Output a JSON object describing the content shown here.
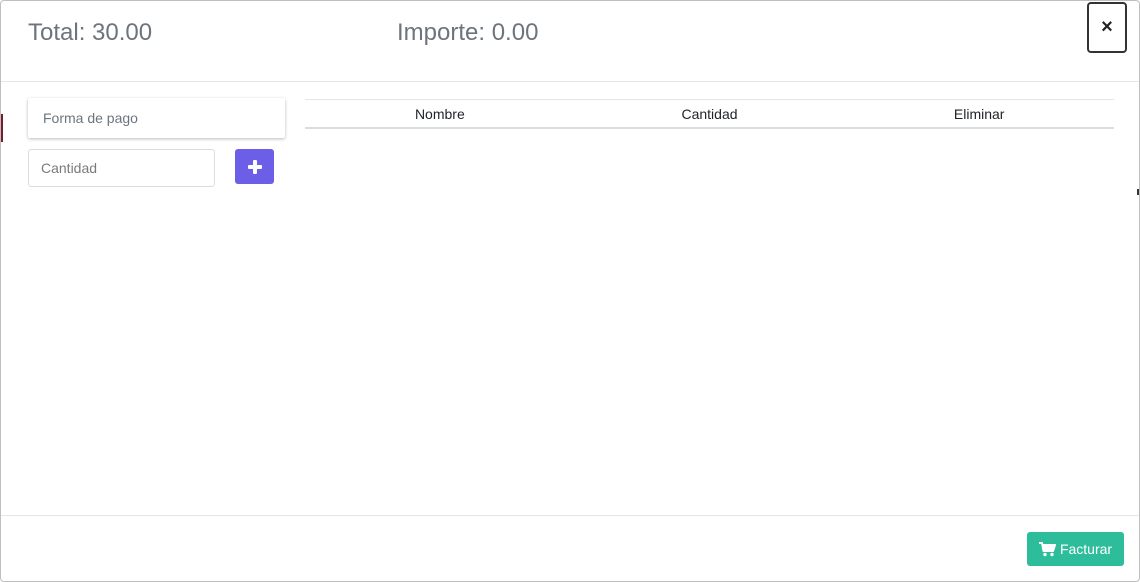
{
  "header": {
    "total_text": "Total: 30.00",
    "importe_text": "Importe: 0.00",
    "close_label": "×"
  },
  "form": {
    "payment_method_placeholder": "Forma de pago",
    "quantity_placeholder": "Cantidad",
    "add_icon": "plus-icon"
  },
  "table": {
    "columns": [
      "Nombre",
      "Cantidad",
      "Eliminar"
    ],
    "rows": []
  },
  "footer": {
    "facturar_label": "Facturar",
    "facturar_icon": "cart-icon"
  },
  "colors": {
    "add_button": "#6d5ee8",
    "facturar_button": "#2ebd9b",
    "header_text": "#6c757d"
  }
}
